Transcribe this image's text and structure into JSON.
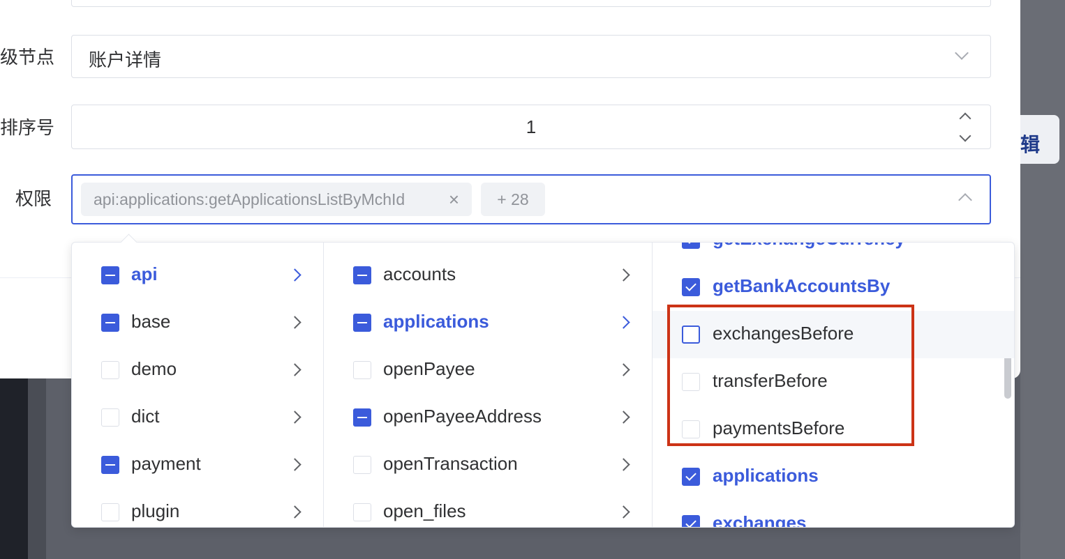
{
  "form": {
    "parent_label": "级节点",
    "parent_value": "账户详情",
    "order_label": "排序号",
    "order_value": "1",
    "perm_label": "权限",
    "perm_tag": "api:applications:getApplicationsListByMchId",
    "perm_more": "+ 28"
  },
  "background": {
    "edit_text": "辑"
  },
  "cascader": {
    "level1": [
      {
        "label": "api",
        "state": "indeterminate",
        "active": true
      },
      {
        "label": "base",
        "state": "indeterminate",
        "active": false
      },
      {
        "label": "demo",
        "state": "unchecked",
        "active": false
      },
      {
        "label": "dict",
        "state": "unchecked",
        "active": false
      },
      {
        "label": "payment",
        "state": "indeterminate",
        "active": false
      },
      {
        "label": "plugin",
        "state": "unchecked",
        "active": false
      }
    ],
    "level2": [
      {
        "label": "accounts",
        "state": "indeterminate",
        "active": false
      },
      {
        "label": "applications",
        "state": "indeterminate",
        "active": true
      },
      {
        "label": "openPayee",
        "state": "unchecked",
        "active": false
      },
      {
        "label": "openPayeeAddress",
        "state": "indeterminate",
        "active": false
      },
      {
        "label": "openTransaction",
        "state": "unchecked",
        "active": false
      },
      {
        "label": "open_files",
        "state": "unchecked",
        "active": false
      }
    ],
    "level3": [
      {
        "label": "getExchangeCurrency",
        "state": "checked"
      },
      {
        "label": "getBankAccountsBy",
        "state": "checked"
      },
      {
        "label": "exchangesBefore",
        "state": "unchecked"
      },
      {
        "label": "transferBefore",
        "state": "unchecked"
      },
      {
        "label": "paymentsBefore",
        "state": "unchecked"
      },
      {
        "label": "applications",
        "state": "checked"
      },
      {
        "label": "exchanges",
        "state": "checked"
      }
    ]
  },
  "colors": {
    "accent": "#3b5bdb",
    "highlight": "#cc3316"
  }
}
